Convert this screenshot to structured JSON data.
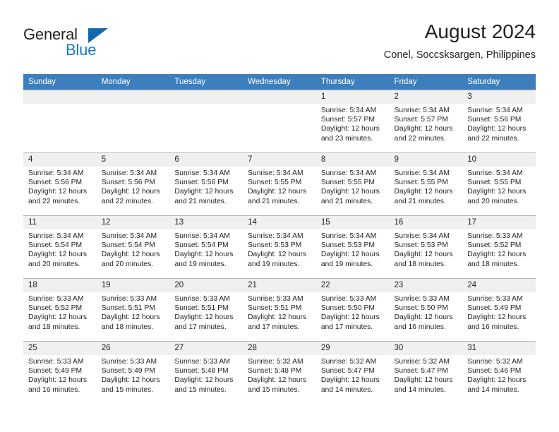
{
  "brand": {
    "name_part1": "General",
    "name_part2": "Blue",
    "accent_color": "#1278be",
    "triangle_color": "#1169ab"
  },
  "header": {
    "title": "August 2024",
    "subtitle": "Conel, Soccsksargen, Philippines"
  },
  "theme": {
    "header_row_bg": "#3d7ebd",
    "day_number_bg": "#f0f0f0",
    "grid_line": "#b6b6b6",
    "text": "#231f20"
  },
  "weekday_headers": [
    "Sunday",
    "Monday",
    "Tuesday",
    "Wednesday",
    "Thursday",
    "Friday",
    "Saturday"
  ],
  "weeks": [
    [
      {
        "day": "",
        "sunrise": "",
        "sunset": "",
        "daylight_line1": "",
        "daylight_line2": ""
      },
      {
        "day": "",
        "sunrise": "",
        "sunset": "",
        "daylight_line1": "",
        "daylight_line2": ""
      },
      {
        "day": "",
        "sunrise": "",
        "sunset": "",
        "daylight_line1": "",
        "daylight_line2": ""
      },
      {
        "day": "",
        "sunrise": "",
        "sunset": "",
        "daylight_line1": "",
        "daylight_line2": ""
      },
      {
        "day": "1",
        "sunrise": "Sunrise: 5:34 AM",
        "sunset": "Sunset: 5:57 PM",
        "daylight_line1": "Daylight: 12 hours",
        "daylight_line2": "and 23 minutes."
      },
      {
        "day": "2",
        "sunrise": "Sunrise: 5:34 AM",
        "sunset": "Sunset: 5:57 PM",
        "daylight_line1": "Daylight: 12 hours",
        "daylight_line2": "and 22 minutes."
      },
      {
        "day": "3",
        "sunrise": "Sunrise: 5:34 AM",
        "sunset": "Sunset: 5:56 PM",
        "daylight_line1": "Daylight: 12 hours",
        "daylight_line2": "and 22 minutes."
      }
    ],
    [
      {
        "day": "4",
        "sunrise": "Sunrise: 5:34 AM",
        "sunset": "Sunset: 5:56 PM",
        "daylight_line1": "Daylight: 12 hours",
        "daylight_line2": "and 22 minutes."
      },
      {
        "day": "5",
        "sunrise": "Sunrise: 5:34 AM",
        "sunset": "Sunset: 5:56 PM",
        "daylight_line1": "Daylight: 12 hours",
        "daylight_line2": "and 22 minutes."
      },
      {
        "day": "6",
        "sunrise": "Sunrise: 5:34 AM",
        "sunset": "Sunset: 5:56 PM",
        "daylight_line1": "Daylight: 12 hours",
        "daylight_line2": "and 21 minutes."
      },
      {
        "day": "7",
        "sunrise": "Sunrise: 5:34 AM",
        "sunset": "Sunset: 5:55 PM",
        "daylight_line1": "Daylight: 12 hours",
        "daylight_line2": "and 21 minutes."
      },
      {
        "day": "8",
        "sunrise": "Sunrise: 5:34 AM",
        "sunset": "Sunset: 5:55 PM",
        "daylight_line1": "Daylight: 12 hours",
        "daylight_line2": "and 21 minutes."
      },
      {
        "day": "9",
        "sunrise": "Sunrise: 5:34 AM",
        "sunset": "Sunset: 5:55 PM",
        "daylight_line1": "Daylight: 12 hours",
        "daylight_line2": "and 21 minutes."
      },
      {
        "day": "10",
        "sunrise": "Sunrise: 5:34 AM",
        "sunset": "Sunset: 5:55 PM",
        "daylight_line1": "Daylight: 12 hours",
        "daylight_line2": "and 20 minutes."
      }
    ],
    [
      {
        "day": "11",
        "sunrise": "Sunrise: 5:34 AM",
        "sunset": "Sunset: 5:54 PM",
        "daylight_line1": "Daylight: 12 hours",
        "daylight_line2": "and 20 minutes."
      },
      {
        "day": "12",
        "sunrise": "Sunrise: 5:34 AM",
        "sunset": "Sunset: 5:54 PM",
        "daylight_line1": "Daylight: 12 hours",
        "daylight_line2": "and 20 minutes."
      },
      {
        "day": "13",
        "sunrise": "Sunrise: 5:34 AM",
        "sunset": "Sunset: 5:54 PM",
        "daylight_line1": "Daylight: 12 hours",
        "daylight_line2": "and 19 minutes."
      },
      {
        "day": "14",
        "sunrise": "Sunrise: 5:34 AM",
        "sunset": "Sunset: 5:53 PM",
        "daylight_line1": "Daylight: 12 hours",
        "daylight_line2": "and 19 minutes."
      },
      {
        "day": "15",
        "sunrise": "Sunrise: 5:34 AM",
        "sunset": "Sunset: 5:53 PM",
        "daylight_line1": "Daylight: 12 hours",
        "daylight_line2": "and 19 minutes."
      },
      {
        "day": "16",
        "sunrise": "Sunrise: 5:34 AM",
        "sunset": "Sunset: 5:53 PM",
        "daylight_line1": "Daylight: 12 hours",
        "daylight_line2": "and 18 minutes."
      },
      {
        "day": "17",
        "sunrise": "Sunrise: 5:33 AM",
        "sunset": "Sunset: 5:52 PM",
        "daylight_line1": "Daylight: 12 hours",
        "daylight_line2": "and 18 minutes."
      }
    ],
    [
      {
        "day": "18",
        "sunrise": "Sunrise: 5:33 AM",
        "sunset": "Sunset: 5:52 PM",
        "daylight_line1": "Daylight: 12 hours",
        "daylight_line2": "and 18 minutes."
      },
      {
        "day": "19",
        "sunrise": "Sunrise: 5:33 AM",
        "sunset": "Sunset: 5:51 PM",
        "daylight_line1": "Daylight: 12 hours",
        "daylight_line2": "and 18 minutes."
      },
      {
        "day": "20",
        "sunrise": "Sunrise: 5:33 AM",
        "sunset": "Sunset: 5:51 PM",
        "daylight_line1": "Daylight: 12 hours",
        "daylight_line2": "and 17 minutes."
      },
      {
        "day": "21",
        "sunrise": "Sunrise: 5:33 AM",
        "sunset": "Sunset: 5:51 PM",
        "daylight_line1": "Daylight: 12 hours",
        "daylight_line2": "and 17 minutes."
      },
      {
        "day": "22",
        "sunrise": "Sunrise: 5:33 AM",
        "sunset": "Sunset: 5:50 PM",
        "daylight_line1": "Daylight: 12 hours",
        "daylight_line2": "and 17 minutes."
      },
      {
        "day": "23",
        "sunrise": "Sunrise: 5:33 AM",
        "sunset": "Sunset: 5:50 PM",
        "daylight_line1": "Daylight: 12 hours",
        "daylight_line2": "and 16 minutes."
      },
      {
        "day": "24",
        "sunrise": "Sunrise: 5:33 AM",
        "sunset": "Sunset: 5:49 PM",
        "daylight_line1": "Daylight: 12 hours",
        "daylight_line2": "and 16 minutes."
      }
    ],
    [
      {
        "day": "25",
        "sunrise": "Sunrise: 5:33 AM",
        "sunset": "Sunset: 5:49 PM",
        "daylight_line1": "Daylight: 12 hours",
        "daylight_line2": "and 16 minutes."
      },
      {
        "day": "26",
        "sunrise": "Sunrise: 5:33 AM",
        "sunset": "Sunset: 5:49 PM",
        "daylight_line1": "Daylight: 12 hours",
        "daylight_line2": "and 15 minutes."
      },
      {
        "day": "27",
        "sunrise": "Sunrise: 5:33 AM",
        "sunset": "Sunset: 5:48 PM",
        "daylight_line1": "Daylight: 12 hours",
        "daylight_line2": "and 15 minutes."
      },
      {
        "day": "28",
        "sunrise": "Sunrise: 5:32 AM",
        "sunset": "Sunset: 5:48 PM",
        "daylight_line1": "Daylight: 12 hours",
        "daylight_line2": "and 15 minutes."
      },
      {
        "day": "29",
        "sunrise": "Sunrise: 5:32 AM",
        "sunset": "Sunset: 5:47 PM",
        "daylight_line1": "Daylight: 12 hours",
        "daylight_line2": "and 14 minutes."
      },
      {
        "day": "30",
        "sunrise": "Sunrise: 5:32 AM",
        "sunset": "Sunset: 5:47 PM",
        "daylight_line1": "Daylight: 12 hours",
        "daylight_line2": "and 14 minutes."
      },
      {
        "day": "31",
        "sunrise": "Sunrise: 5:32 AM",
        "sunset": "Sunset: 5:46 PM",
        "daylight_line1": "Daylight: 12 hours",
        "daylight_line2": "and 14 minutes."
      }
    ]
  ]
}
